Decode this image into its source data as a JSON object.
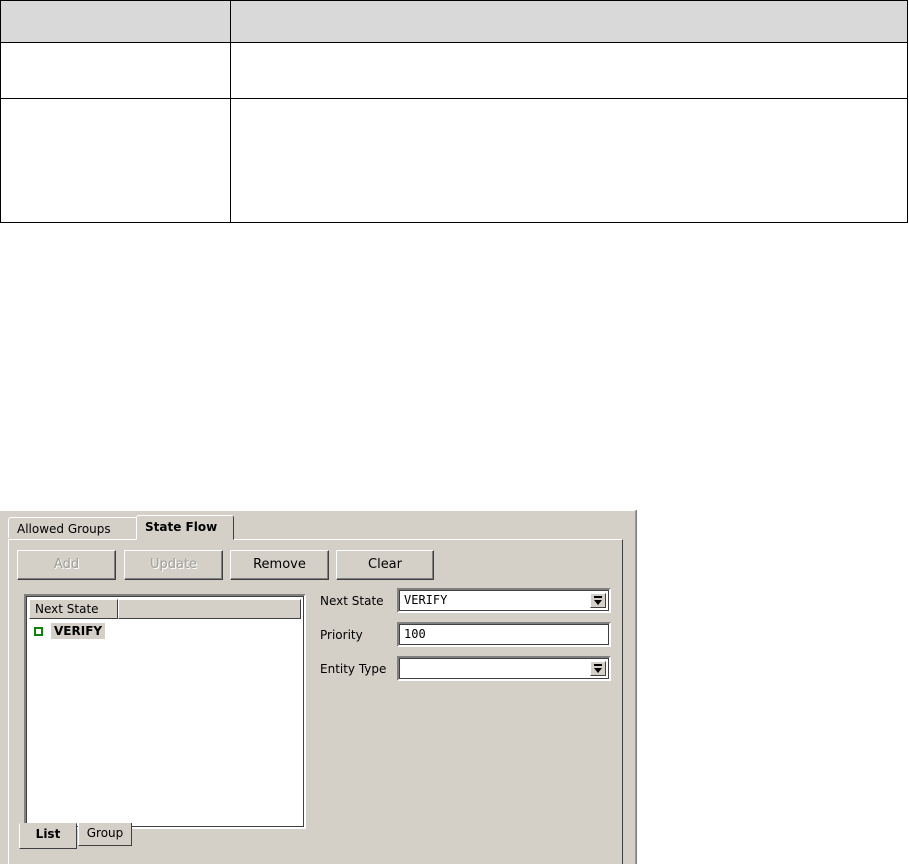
{
  "tabs": {
    "allowed_groups": "Allowed Groups",
    "state_flow": "State Flow"
  },
  "toolbar": {
    "add": "Add",
    "update": "Update",
    "remove": "Remove",
    "clear": "Clear"
  },
  "list": {
    "column_header": "Next State",
    "rows": [
      {
        "label": "VERIFY"
      }
    ]
  },
  "bottom_tabs": {
    "list": "List",
    "group": "Group"
  },
  "form": {
    "next_state_label": "Next State",
    "next_state_value": "VERIFY",
    "priority_label": "Priority",
    "priority_value": "100",
    "entity_type_label": "Entity Type",
    "entity_type_value": ""
  },
  "colors": {
    "panel_bg": "#d4d0c8",
    "row_icon": "#108010"
  }
}
